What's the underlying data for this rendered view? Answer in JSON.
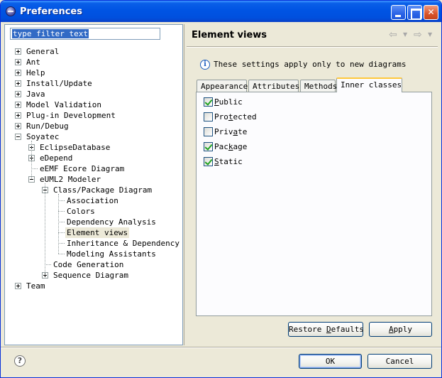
{
  "window": {
    "title": "Preferences"
  },
  "filter": {
    "value": "type filter text"
  },
  "tree": [
    {
      "label": "General",
      "depth": 0,
      "toggle": "plus"
    },
    {
      "label": "Ant",
      "depth": 0,
      "toggle": "plus"
    },
    {
      "label": "Help",
      "depth": 0,
      "toggle": "plus"
    },
    {
      "label": "Install/Update",
      "depth": 0,
      "toggle": "plus"
    },
    {
      "label": "Java",
      "depth": 0,
      "toggle": "plus"
    },
    {
      "label": "Model Validation",
      "depth": 0,
      "toggle": "plus"
    },
    {
      "label": "Plug-in Development",
      "depth": 0,
      "toggle": "plus"
    },
    {
      "label": "Run/Debug",
      "depth": 0,
      "toggle": "plus"
    },
    {
      "label": "Soyatec",
      "depth": 0,
      "toggle": "minus"
    },
    {
      "label": "EclipseDatabase",
      "depth": 1,
      "toggle": "plus"
    },
    {
      "label": "eDepend",
      "depth": 1,
      "toggle": "plus"
    },
    {
      "label": "eEMF Ecore Diagram",
      "depth": 1,
      "toggle": "none"
    },
    {
      "label": "eUML2 Modeler",
      "depth": 1,
      "toggle": "minus"
    },
    {
      "label": "Class/Package Diagram",
      "depth": 2,
      "toggle": "minus"
    },
    {
      "label": "Association",
      "depth": 3,
      "toggle": "none"
    },
    {
      "label": "Colors",
      "depth": 3,
      "toggle": "none"
    },
    {
      "label": "Dependency Analysis",
      "depth": 3,
      "toggle": "none"
    },
    {
      "label": "Element views",
      "depth": 3,
      "toggle": "none",
      "selected": true
    },
    {
      "label": "Inheritance & Dependency",
      "depth": 3,
      "toggle": "none"
    },
    {
      "label": "Modeling Assistants",
      "depth": 3,
      "toggle": "none"
    },
    {
      "label": "Code Generation",
      "depth": 2,
      "toggle": "none"
    },
    {
      "label": "Sequence Diagram",
      "depth": 2,
      "toggle": "plus"
    },
    {
      "label": "Team",
      "depth": 0,
      "toggle": "plus"
    }
  ],
  "page": {
    "title": "Element views",
    "info": "These settings apply only to new diagrams"
  },
  "nav": {
    "back_glyph": "⇦",
    "forward_glyph": "⇨",
    "drop_glyph": "▼"
  },
  "tabs": [
    {
      "label": "Appearance"
    },
    {
      "label": "Attributes"
    },
    {
      "label": "Methods"
    },
    {
      "label": "Inner classes",
      "active": true
    }
  ],
  "options": [
    {
      "label": "Public",
      "checked": true,
      "mnemonic_index": 0
    },
    {
      "label": "Protected",
      "checked": false,
      "mnemonic_index": 3
    },
    {
      "label": "Private",
      "checked": false,
      "mnemonic_index": 4
    },
    {
      "label": "Package",
      "checked": true,
      "mnemonic_index": 3
    },
    {
      "label": "Static",
      "checked": true,
      "mnemonic_index": 0
    }
  ],
  "buttons": {
    "restore_defaults": "Restore Defaults",
    "apply": "Apply",
    "ok": "OK",
    "cancel": "Cancel"
  },
  "icons": {
    "window": "eclipse-icon",
    "info": "info-icon",
    "help": "help-icon"
  },
  "colors": {
    "titlebar": "#0054e3",
    "selection": "#316ac5",
    "active_tab_accent": "#ffc83c",
    "check": "#21a121"
  }
}
